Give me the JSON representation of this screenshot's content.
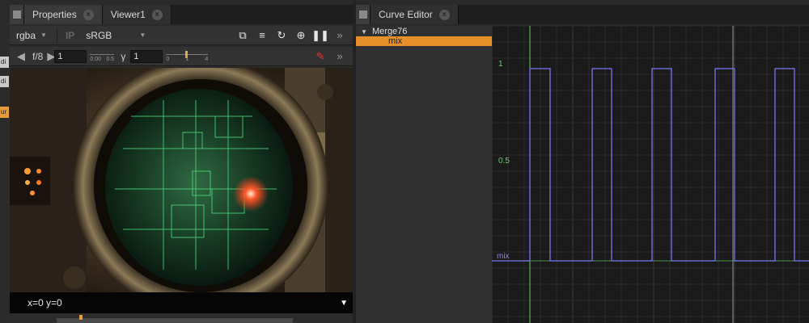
{
  "left_panel": {
    "tabs": [
      {
        "label": "Properties",
        "active": false
      },
      {
        "label": "Viewer1",
        "active": true
      }
    ]
  },
  "viewer": {
    "channels": "rgba",
    "ip_label": "IP",
    "colorspace": "sRGB",
    "fstop": "f/8",
    "gain_value": "1",
    "gamma_label": "γ",
    "gamma_value": "1",
    "gain_ticks": [
      "0.00",
      "0.5"
    ],
    "gamma_ticks": [
      "0",
      "1",
      "4"
    ],
    "coords": "x=0 y=0"
  },
  "node_strip": [
    "di",
    "di",
    "ur"
  ],
  "curve_editor": {
    "tab_label": "Curve Editor",
    "tree": {
      "node": "Merge76",
      "knob": "mix"
    },
    "y_labels": [
      "1",
      "0.5",
      "mix"
    ],
    "curve_color": "#6b6bd6",
    "current_frame_color": "#9a9a9a",
    "start_line_color": "#5fd35f"
  },
  "chart_data": {
    "type": "line",
    "series": [
      {
        "name": "mix",
        "step": true,
        "values": [
          [
            0,
            0
          ],
          [
            1,
            1
          ],
          [
            2,
            0
          ],
          [
            3,
            1
          ],
          [
            4,
            0
          ],
          [
            5,
            1
          ],
          [
            6,
            0
          ],
          [
            7,
            1
          ],
          [
            8,
            0
          ],
          [
            9,
            1
          ]
        ]
      }
    ],
    "ytick_labels": [
      "1",
      "0.5"
    ],
    "ylim": [
      0,
      1
    ],
    "grid": true
  }
}
